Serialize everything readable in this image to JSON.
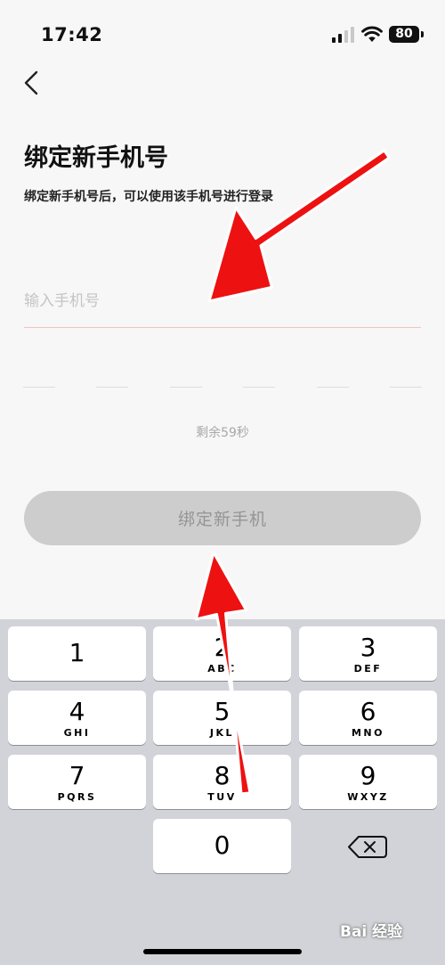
{
  "status_bar": {
    "time": "17:42",
    "battery": "80"
  },
  "page": {
    "title": "绑定新手机号",
    "subtitle": "绑定新手机号后，可以使用该手机号进行登录",
    "phone_input": {
      "value": "",
      "placeholder": "输入手机号"
    },
    "code_digits": [
      "",
      "",
      "",
      "",
      "",
      ""
    ],
    "countdown": "剩余59秒",
    "bind_button_label": "绑定新手机"
  },
  "keyboard": {
    "keys": [
      {
        "num": "1",
        "letters": ""
      },
      {
        "num": "2",
        "letters": "ABC"
      },
      {
        "num": "3",
        "letters": "DEF"
      },
      {
        "num": "4",
        "letters": "GHI"
      },
      {
        "num": "5",
        "letters": "JKL"
      },
      {
        "num": "6",
        "letters": "MNO"
      },
      {
        "num": "7",
        "letters": "PQRS"
      },
      {
        "num": "8",
        "letters": "TUV"
      },
      {
        "num": "9",
        "letters": "WXYZ"
      },
      {
        "num": "0",
        "letters": ""
      }
    ]
  },
  "watermark": "Bai 经验",
  "icons": {
    "back": "chevron-left-icon",
    "delete": "backspace-icon",
    "signal": "cellular-signal-icon",
    "wifi": "wifi-icon",
    "battery": "battery-icon",
    "annotation": "red-arrow-icon"
  },
  "colors": {
    "arrow": "#ee1111",
    "button_bg": "#cdcdcd",
    "underline_active": "#f0c4c0"
  }
}
